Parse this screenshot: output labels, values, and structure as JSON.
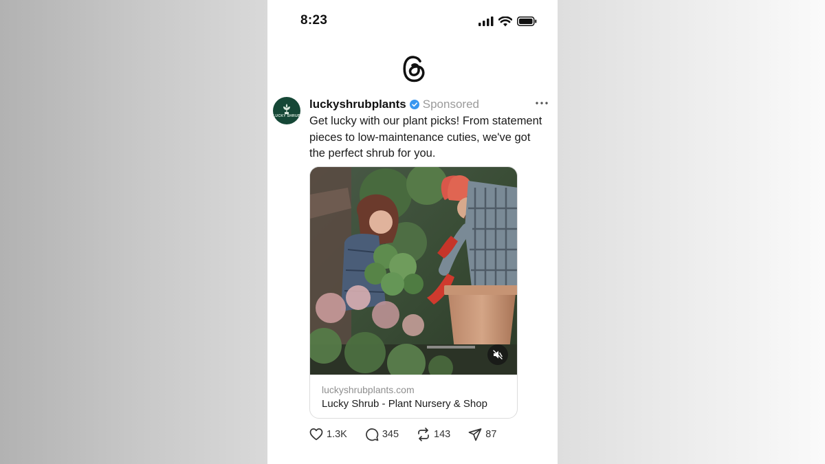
{
  "status_bar": {
    "time": "8:23",
    "icons": [
      "signal-icon",
      "wifi-icon",
      "battery-icon"
    ]
  },
  "app": {
    "logo_icon": "threads-logo-icon"
  },
  "post": {
    "avatar_text": "LUCKY SHRUB",
    "username": "luckyshrubplants",
    "verified": true,
    "sponsored_label": "Sponsored",
    "text": "Get lucky with our plant picks! From statement pieces to low-maintenance cuties, we've got the perfect shrub for you.",
    "media": {
      "type": "video",
      "muted": true
    },
    "link": {
      "domain": "luckyshrubplants.com",
      "title": "Lucky Shrub - Plant Nursery & Shop"
    },
    "actions": {
      "likes": "1.3K",
      "replies": "345",
      "reposts": "143",
      "shares": "87"
    }
  },
  "colors": {
    "verified_blue": "#3897f0",
    "avatar_green": "#154736",
    "muted_text": "#9a9a9a"
  }
}
